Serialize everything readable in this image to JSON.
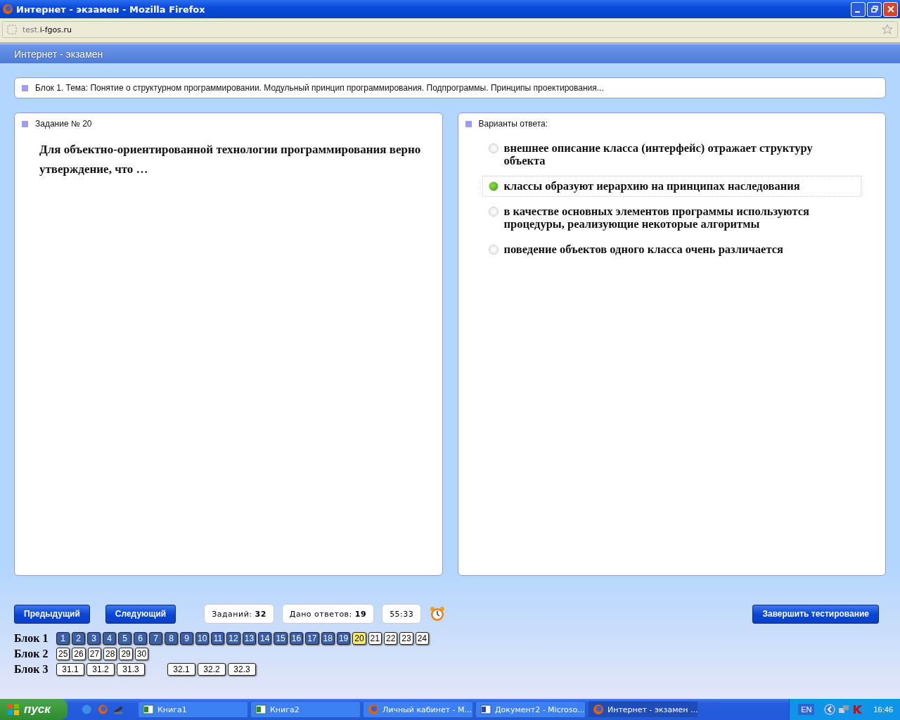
{
  "window": {
    "title": "Интернет - экзамен - Mozilla Firefox"
  },
  "address_bar": {
    "subdomain": "test.",
    "domain": "i-fgos.ru"
  },
  "page_header": "Интернет - экзамен",
  "topic": "Блок 1. Тема: Понятие о структурном программировании. Модульный принцип программирования. Подпрограммы. Принципы проектирования...",
  "question": {
    "heading": "Задание № 20",
    "text": "Для объектно-ориентированной технологии программирования верно утверждение, что …"
  },
  "answers": {
    "heading": "Варианты ответа:",
    "options": [
      {
        "text": "внешнее описание класса (интерфейс) отражает структуру объекта",
        "selected": false
      },
      {
        "text": "классы образуют иерархию на принципах наследования",
        "selected": true
      },
      {
        "text": "в качестве основных элементов программы используются процедуры, реализующие некоторые алгоритмы",
        "selected": false
      },
      {
        "text": "поведение объектов одного класса очень различается",
        "selected": false
      }
    ]
  },
  "nav_buttons": [
    "Предыдущий",
    "Следующий"
  ],
  "stats": [
    "Заданий: **32**",
    "Дано ответов: **19**",
    "55:33"
  ],
  "finish_button": "Завершить тестирование",
  "blocks": [
    {
      "label": "Блок 1",
      "groups": [
        [
          {
            "label": "1",
            "answered": true,
            "selected": false
          },
          {
            "label": "2",
            "answered": true,
            "selected": false
          },
          {
            "label": "3",
            "answered": true,
            "selected": false
          },
          {
            "label": "4",
            "answered": true,
            "selected": false
          },
          {
            "label": "5",
            "answered": true,
            "selected": false
          },
          {
            "label": "6",
            "answered": true,
            "selected": false
          },
          {
            "label": "7",
            "answered": true,
            "selected": false
          },
          {
            "label": "8",
            "answered": true,
            "selected": false
          },
          {
            "label": "9",
            "answered": true,
            "selected": false
          },
          {
            "label": "10",
            "answered": true,
            "selected": false
          },
          {
            "label": "11",
            "answered": true,
            "selected": false
          },
          {
            "label": "12",
            "answered": true,
            "selected": false
          },
          {
            "label": "13",
            "answered": true,
            "selected": false
          },
          {
            "label": "14",
            "answered": true,
            "selected": false
          },
          {
            "label": "15",
            "answered": true,
            "selected": false
          },
          {
            "label": "16",
            "answered": true,
            "selected": false
          },
          {
            "label": "17",
            "answered": true,
            "selected": false
          },
          {
            "label": "18",
            "answered": true,
            "selected": false
          },
          {
            "label": "19",
            "answered": true,
            "selected": false
          },
          {
            "label": "20",
            "answered": false,
            "selected": true
          },
          {
            "label": "21",
            "answered": false,
            "selected": false
          },
          {
            "label": "22",
            "answered": false,
            "selected": false
          },
          {
            "label": "23",
            "answered": false,
            "selected": false
          },
          {
            "label": "24",
            "answered": false,
            "selected": false
          }
        ]
      ]
    },
    {
      "label": "Блок 2",
      "groups": [
        [
          {
            "label": "25",
            "answered": false,
            "selected": false
          },
          {
            "label": "26",
            "answered": false,
            "selected": false
          },
          {
            "label": "27",
            "answered": false,
            "selected": false
          },
          {
            "label": "28",
            "answered": false,
            "selected": false
          },
          {
            "label": "29",
            "answered": false,
            "selected": false
          },
          {
            "label": "30",
            "answered": false,
            "selected": false
          }
        ]
      ]
    },
    {
      "label": "Блок 3",
      "groups": [
        [
          {
            "label": "31.1",
            "answered": false,
            "selected": false
          },
          {
            "label": "31.2",
            "answered": false,
            "selected": false
          },
          {
            "label": "31.3",
            "answered": false,
            "selected": false
          }
        ],
        [
          {
            "label": "32.1",
            "answered": false,
            "selected": false
          },
          {
            "label": "32.2",
            "answered": false,
            "selected": false
          },
          {
            "label": "32.3",
            "answered": false,
            "selected": false
          }
        ]
      ]
    }
  ],
  "taskbar": {
    "start": "пуск",
    "tasks": [
      {
        "label": "Книга1",
        "kind": "excel",
        "selected": false
      },
      {
        "label": "Книга2",
        "kind": "excel",
        "selected": false
      },
      {
        "label": "Личный кабинет - М...",
        "kind": "firefox",
        "selected": false
      },
      {
        "label": "Документ2 - Microso...",
        "kind": "word",
        "selected": false
      },
      {
        "label": "Интернет - экзамен ...",
        "kind": "firefox",
        "selected": true
      }
    ],
    "language": "EN",
    "clock": "16:46"
  }
}
